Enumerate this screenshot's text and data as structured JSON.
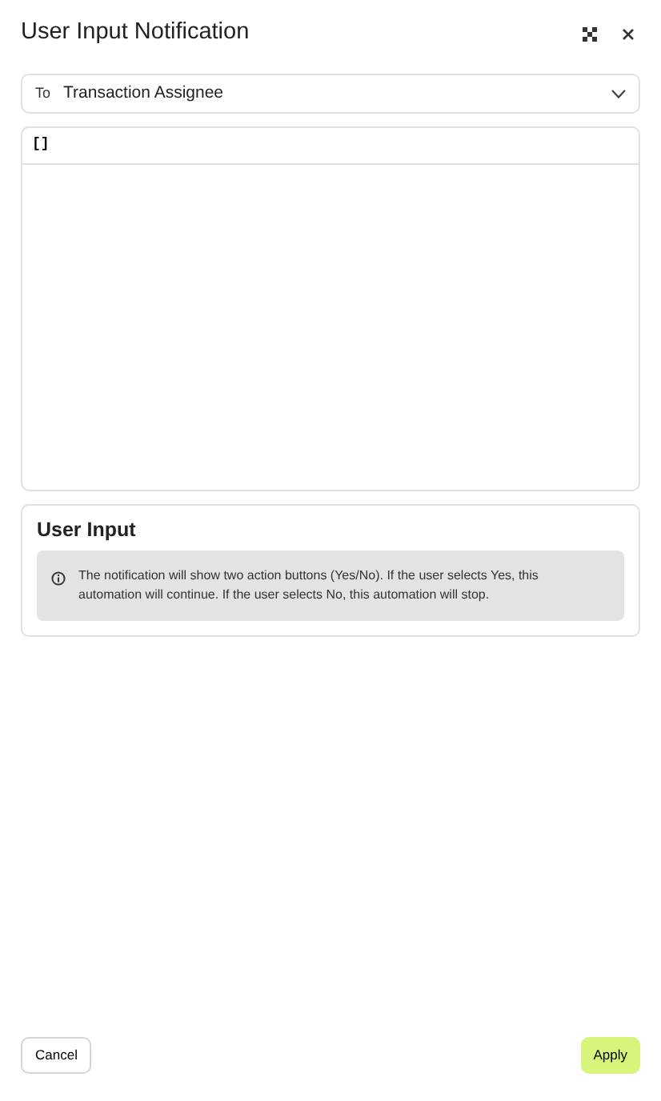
{
  "window": {
    "title": "User Input Notification"
  },
  "recipient": {
    "label": "To",
    "value": "Transaction Assignee"
  },
  "editor": {
    "toolbar_button": "[]"
  },
  "user_input": {
    "title": "User Input",
    "info": "The notification will show two action buttons (Yes/No). If the user selects Yes, this automation will continue. If the user selects No, this automation will stop."
  },
  "buttons": [
    {
      "label": "Cancel",
      "kind": "secondary"
    },
    {
      "label": "Apply",
      "kind": "primary"
    }
  ]
}
